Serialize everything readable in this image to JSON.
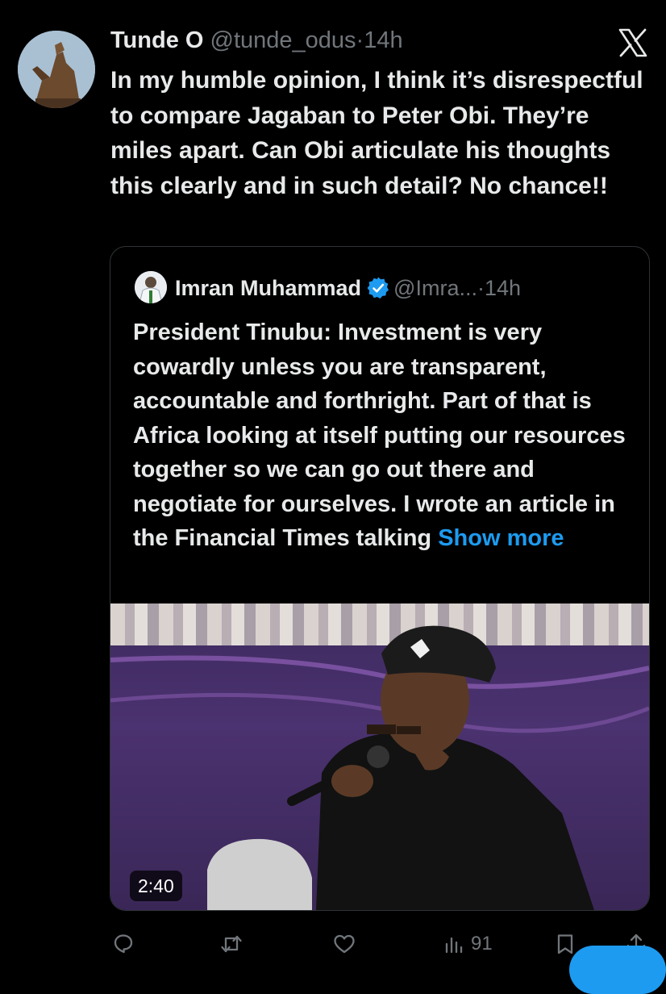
{
  "tweet": {
    "author_name": "Tunde O",
    "handle": "@tunde_odus",
    "dot": "·",
    "time": "14h",
    "text": "In my humble opinion, I think it’s disrespectful to compare Jagaban to Peter Obi. They’re miles apart. Can Obi articulate his thoughts this clearly and in such detail? No chance!!"
  },
  "quoted_tweet": {
    "author_name": "Imran Muhammad",
    "handle": "@Imra...",
    "dot": "·",
    "time": "14h",
    "verified": true,
    "text": "President Tinubu: Investment is very cowardly unless you are transparent, accountable and forthright. Part of that is Africa looking at itself putting our resources together so we can go out there and negotiate for ourselves. I wrote an article in the Financial Times talking",
    "show_more": "Show more",
    "video_duration": "2:40"
  },
  "actions": {
    "reply_icon": "reply-icon",
    "retweet_icon": "retweet-icon",
    "like_icon": "heart-icon",
    "views_icon": "views-icon",
    "views_count": "91",
    "bookmark_icon": "bookmark-icon",
    "share_icon": "share-icon"
  },
  "colors": {
    "background": "#000000",
    "text": "#e7e9ea",
    "muted": "#71767b",
    "accent": "#1d9bf0"
  }
}
